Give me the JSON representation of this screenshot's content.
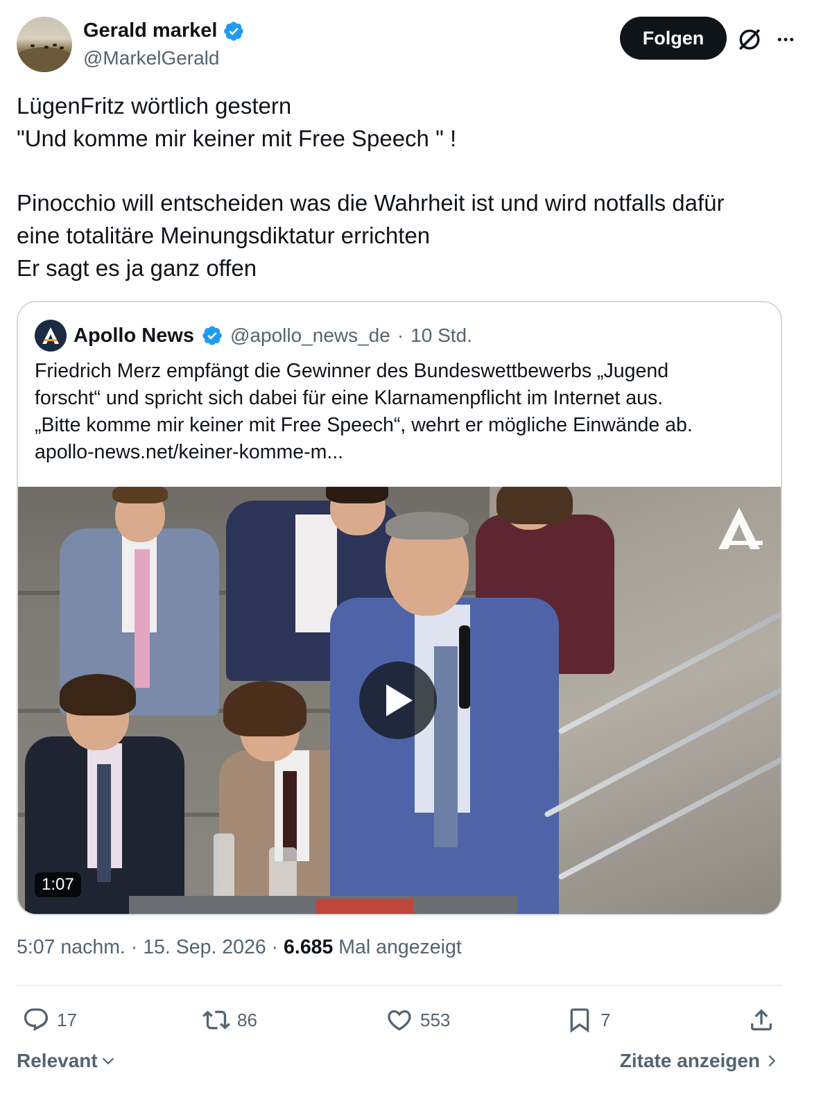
{
  "author": {
    "name": "Gerald markel",
    "handle": "@MarkelGerald",
    "verified": true
  },
  "header": {
    "follow_label": "Folgen",
    "grok_icon": "grok-icon",
    "more_icon": "more-icon"
  },
  "tweet": {
    "lines": [
      "LügenFritz wörtlich gestern",
      "\"Und komme mir keiner mit Free Speech \" !",
      "",
      "Pinocchio will entscheiden was die Wahrheit ist und wird notfalls dafür",
      "eine totalitäre Meinungsdiktatur errichten",
      "Er sagt es ja ganz offen"
    ]
  },
  "quote": {
    "name": "Apollo News",
    "handle": "@apollo_news_de",
    "separator": "·",
    "time": "10 Std.",
    "logo_letter": "A",
    "lines": [
      "Friedrich Merz empfängt die Gewinner des Bundeswettbewerbs „Jugend",
      "forscht“ und spricht sich dabei für eine Klarnamenpflicht im Internet aus.",
      "„Bitte komme mir keiner mit Free Speech“, wehrt er mögliche Einwände ab.",
      "apollo-news.net/keiner-komme-m..."
    ],
    "video": {
      "duration": "1:07",
      "play_icon": "play-icon",
      "watermark": "A"
    }
  },
  "meta": {
    "time": "5:07 nachm.",
    "sep1": "·",
    "date": "15. Sep. 2026",
    "sep2": "·",
    "views": "6.685",
    "views_label": "Mal angezeigt"
  },
  "actions": {
    "replies": "17",
    "reposts": "86",
    "likes": "553",
    "bookmarks": "7"
  },
  "footer": {
    "sort_label": "Relevant",
    "quotes_label": "Zitate anzeigen"
  },
  "colors": {
    "text": "#0f1419",
    "secondary": "#536471",
    "verified": "#1d9bf0",
    "border": "#cfd9de"
  }
}
